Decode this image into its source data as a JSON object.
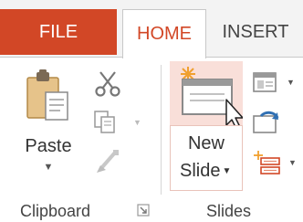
{
  "tabs": {
    "file": "FILE",
    "home": "HOME",
    "insert": "INSERT"
  },
  "clipboard": {
    "paste_label": "Paste",
    "group_label": "Clipboard",
    "icons": [
      "paste-icon",
      "cut-icon",
      "copy-icon",
      "format-painter-icon"
    ]
  },
  "slides": {
    "new_slide_line1": "New",
    "new_slide_line2": "Slide",
    "group_label": "Slides",
    "icons": [
      "new-slide-icon",
      "layout-icon",
      "reset-icon",
      "section-icon"
    ]
  },
  "colors": {
    "accent": "#d24726",
    "hover": "#f9dfd9"
  }
}
